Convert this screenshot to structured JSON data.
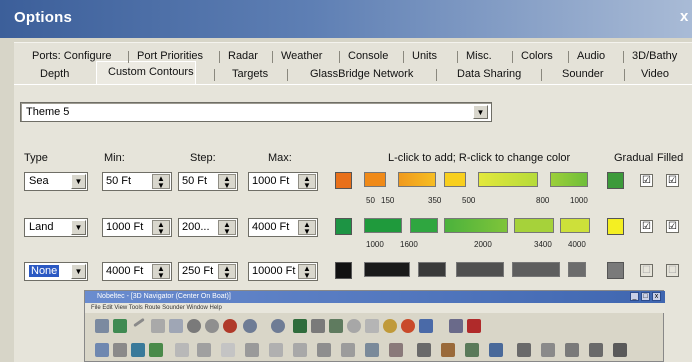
{
  "window": {
    "title": "Options",
    "close_glyph": "x"
  },
  "tabs": {
    "row1": [
      "Ports: Configure",
      "Port Priorities",
      "Radar",
      "Weather",
      "Console",
      "Units",
      "Misc.",
      "Colors",
      "Audio",
      "3D/Bathy"
    ],
    "row2": [
      "Depth",
      "Custom Contours",
      "Targets",
      "GlassBridge Network",
      "Data Sharing",
      "Sounder",
      "Video"
    ],
    "active": "Custom Contours"
  },
  "theme": {
    "value": "Theme 5"
  },
  "headers": {
    "type": "Type",
    "min": "Min:",
    "step": "Step:",
    "max": "Max:",
    "hint": "L-click to add; R-click to change color",
    "gradual": "Gradual",
    "filled": "Filled"
  },
  "rows": [
    {
      "type": "Sea",
      "min": "50 Ft",
      "step": "50 Ft",
      "max": "1000 Ft",
      "start_color": "#e8701a",
      "end_color": "#3c9a3a",
      "ticks": [
        "50",
        "150",
        "350",
        "500",
        "800",
        "1000"
      ],
      "gradual": "☑",
      "filled": "☑"
    },
    {
      "type": "Land",
      "min": "1000 Ft",
      "step": "200...",
      "max": "4000 Ft",
      "start_color": "#1d9444",
      "end_color": "#f4ef22",
      "ticks": [
        "1000",
        "1600",
        "2000",
        "3400",
        "4000"
      ],
      "gradual": "☑",
      "filled": "☑"
    },
    {
      "type": "None",
      "min": "4000 Ft",
      "step": "250 Ft",
      "max": "10000 Ft",
      "start_color": "#111111",
      "end_color": "#7a7a7a",
      "ticks": [],
      "gradual": "☐",
      "filled": "☐"
    }
  ],
  "subwindow": {
    "title": "Nobeltec - [3D Navigator (Center On Boat)]",
    "menu": "File  Edit  View  Tools  Route  Sounder  Window  Help"
  },
  "icons": {
    "dropdown": "▼",
    "spin_up": "▲",
    "spin_down": "▼"
  }
}
